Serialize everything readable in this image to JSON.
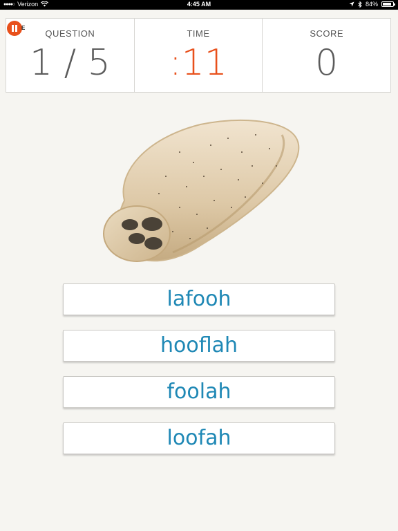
{
  "status_bar": {
    "carrier": "Verizon",
    "time": "4:45 AM",
    "battery": "84%",
    "battery_fraction": 0.84
  },
  "scoreboard": {
    "question_label": "QUESTION",
    "question_value": "1 / 5",
    "time_label": "TIME",
    "time_value": ":11",
    "score_label": "SCORE",
    "score_value": "0"
  },
  "controls": {
    "badge": "E"
  },
  "answers": [
    "lafooh",
    "hooflah",
    "foolah",
    "loofah"
  ],
  "colors": {
    "accent_orange": "#e8501b",
    "answer_blue": "#1f88b5"
  },
  "icons": {
    "pause": "pause-icon",
    "wifi": "wifi-icon",
    "location": "location-icon",
    "bluetooth": "bluetooth-icon",
    "battery": "battery-icon"
  }
}
